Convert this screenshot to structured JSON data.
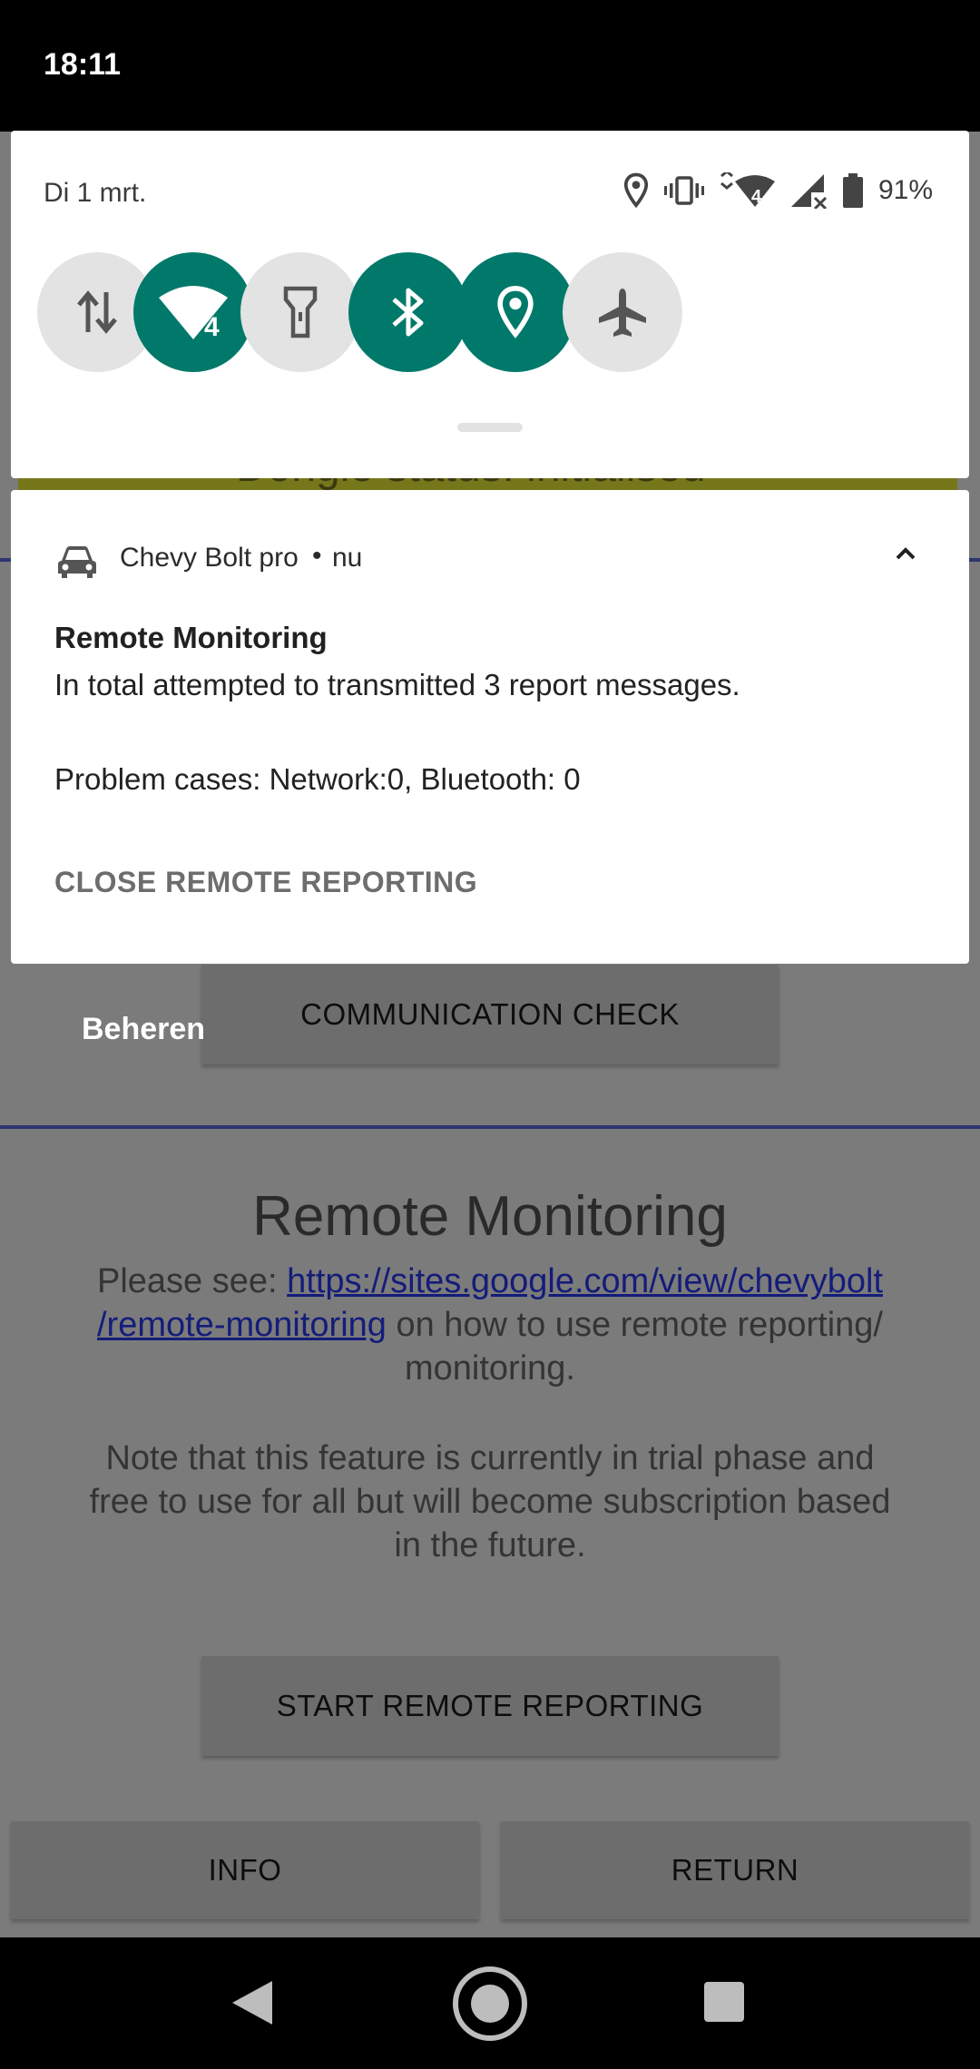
{
  "statusbar": {
    "time": "18:11"
  },
  "quick_settings": {
    "date": "Di 1 mrt.",
    "battery_percent": "91%",
    "network_badge": "4",
    "tiles": [
      {
        "name": "mobile-data",
        "icon": "data-arrows-icon",
        "active": false
      },
      {
        "name": "wifi",
        "icon": "wifi-icon",
        "active": true,
        "badge": "4"
      },
      {
        "name": "flashlight",
        "icon": "flashlight-icon",
        "active": false
      },
      {
        "name": "bluetooth",
        "icon": "bluetooth-icon",
        "active": true
      },
      {
        "name": "location",
        "icon": "location-icon",
        "active": true
      },
      {
        "name": "airplane-mode",
        "icon": "airplane-icon",
        "active": false
      }
    ]
  },
  "notification": {
    "app_name": "Chevy Bolt pro",
    "separator": "•",
    "time": "nu",
    "title": "Remote Monitoring",
    "line1": "In total attempted to transmitted 3 report messages.",
    "line2": "Problem cases: Network:0, Bluetooth: 0",
    "action": "CLOSE REMOTE REPORTING"
  },
  "shade": {
    "manage_label": "Beheren"
  },
  "app": {
    "banner_text": "Dongle status: initialised",
    "communication_check": "COMMUNICATION CHECK",
    "section_title": "Remote Monitoring",
    "see_prefix": "Please see: ",
    "link_line1": "https://sites.google.com/view/chevybolt",
    "link_line2": "/remote-monitoring",
    "see_suffix": " on how to use remote reporting/",
    "see_line3": "monitoring.",
    "note_line1": "Note that this feature is currently in trial phase and",
    "note_line2": "free to use for all but will become subscription based",
    "note_line3": "in the future.",
    "start_button": "START REMOTE REPORTING",
    "info_button": "INFO",
    "return_button": "RETURN"
  },
  "colors": {
    "accent": "#00796b",
    "tile_off": "#e3e3e3",
    "link": "#141c7a"
  }
}
